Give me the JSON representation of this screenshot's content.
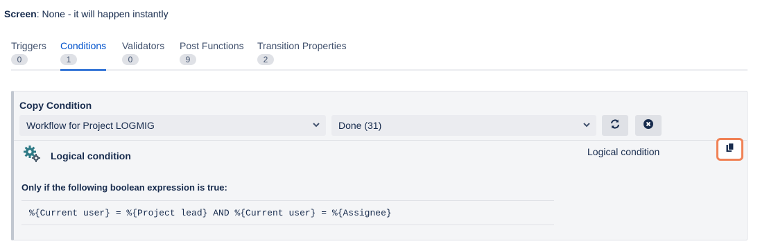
{
  "screen": {
    "label": "Screen",
    "value": ": None - it will happen instantly"
  },
  "tabs": [
    {
      "label": "Triggers",
      "count": "0"
    },
    {
      "label": "Conditions",
      "count": "1"
    },
    {
      "label": "Validators",
      "count": "0"
    },
    {
      "label": "Post Functions",
      "count": "9"
    },
    {
      "label": "Transition Properties",
      "count": "2"
    }
  ],
  "active_tab": "Conditions",
  "copy_condition": {
    "title": "Copy Condition",
    "workflow_select": "Workflow for Project LOGMIG",
    "transition_select": "Done (31)",
    "refresh_icon": "refresh-icon",
    "clear_icon": "clear-icon"
  },
  "condition": {
    "icon": "gears-icon",
    "name": "Logical condition",
    "type": "Logical condition",
    "copy_icon": "copy-icon",
    "expression_title": "Only if the following boolean expression is true:",
    "expression": "%{Current user} = %{Project lead} AND %{Current user} = %{Assignee}"
  },
  "colors": {
    "accent": "#0052cc",
    "highlight": "#f08155",
    "panel_bg": "#f4f5f7"
  }
}
